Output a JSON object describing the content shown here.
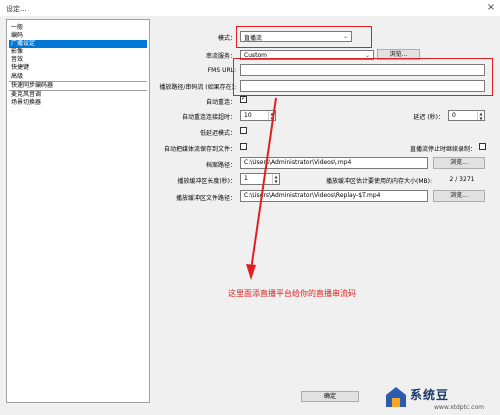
{
  "window": {
    "title": "设定...",
    "close_glyph": "×"
  },
  "sidebar": {
    "items": [
      {
        "label": "一般"
      },
      {
        "label": "编码"
      },
      {
        "label": "广播设定"
      },
      {
        "label": "影像"
      },
      {
        "label": "音效"
      },
      {
        "label": "快捷键"
      },
      {
        "label": "高级"
      },
      {
        "label": "快速同步编码器"
      },
      {
        "label": "麦克风音调"
      },
      {
        "label": "场景切换器"
      }
    ]
  },
  "form": {
    "mode": {
      "label": "模式：",
      "value": "直播流"
    },
    "service": {
      "label": "串流服务：",
      "value": "Custom",
      "browse": "浏览..."
    },
    "fms_url": {
      "label": "FMS URL:",
      "value": ""
    },
    "playpath": {
      "label": "播放路径/串码流 (如果存在):",
      "value": ""
    },
    "auto_reconnect": {
      "label": "自动重连：",
      "checked": true
    },
    "reconnect_timeout": {
      "label": "自动重连连接超时：",
      "value": "10"
    },
    "delay": {
      "label": "延迟 (秒)：",
      "value": "0"
    },
    "low_latency": {
      "label": "低延迟模式：",
      "checked": false
    },
    "save_to_file": {
      "label": "自动把媒体流保存到文件：",
      "checked": false
    },
    "keep_recording": {
      "label": "直播流停止时继续录制：",
      "checked": false
    },
    "archive_path": {
      "label": "档案路径：",
      "value": "C:\\Users\\Administrator\\Videos\\.mp4",
      "browse": "浏览..."
    },
    "replay_length": {
      "label": "播放缓冲区长度(秒)：",
      "value": "1"
    },
    "replay_memory": {
      "label": "播放缓冲区估计要使用的内存大小(MB):",
      "value": "2 / 3271"
    },
    "replay_path": {
      "label": "播放缓冲区文件路径：",
      "value": "C:\\Users\\Administrator\\Videos\\Replay-$T.mp4",
      "browse": "浏览..."
    }
  },
  "annotation": {
    "text": "这里面添直播平台给你的直播串流码",
    "color": "#e02020"
  },
  "footer": {
    "ok": "确定"
  },
  "watermark": {
    "brand": "系统豆",
    "url": "www.xtdptc.com"
  },
  "colors": {
    "selection": "#0078d7",
    "annotation_red": "#e02020"
  }
}
